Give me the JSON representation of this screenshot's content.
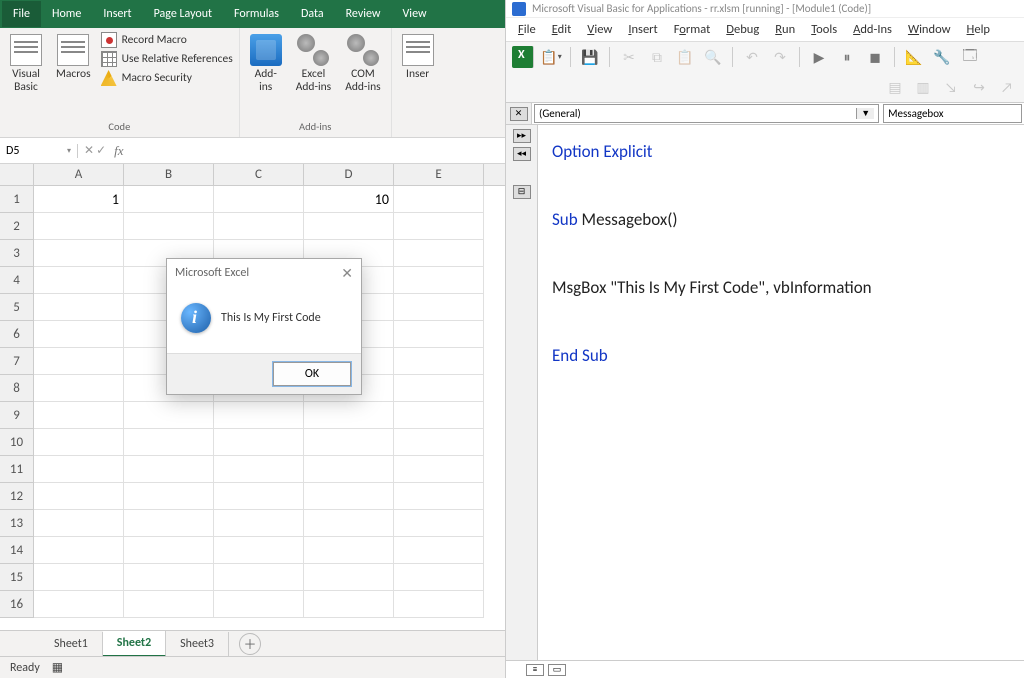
{
  "excel": {
    "tabs": [
      "File",
      "Home",
      "Insert",
      "Page Layout",
      "Formulas",
      "Data",
      "Review",
      "View"
    ],
    "ribbon": {
      "group1": {
        "big1": "Visual\nBasic",
        "big2": "Macros",
        "small1": "Record Macro",
        "small2": "Use Relative References",
        "small3": "Macro Security",
        "label": "Code"
      },
      "group2": {
        "big1": "Add-\nins",
        "big2": "Excel\nAdd-ins",
        "big3": "COM\nAdd-ins",
        "label": "Add-ins"
      },
      "group3": {
        "big1": "Inser"
      }
    },
    "namebox": "D5",
    "fx": "fx",
    "formula": "",
    "columns": [
      "A",
      "B",
      "C",
      "D",
      "E"
    ],
    "rows": [
      "1",
      "2",
      "3",
      "4",
      "5",
      "6",
      "7",
      "8",
      "9",
      "10",
      "11",
      "12",
      "13",
      "14",
      "15",
      "16"
    ],
    "cells": {
      "A1": "1",
      "D1": "10"
    },
    "sheet_tabs": [
      "Sheet1",
      "Sheet2",
      "Sheet3"
    ],
    "active_sheet": 1,
    "status": "Ready"
  },
  "msgbox": {
    "title": "Microsoft Excel",
    "text": "This Is My First Code",
    "ok": "OK"
  },
  "vba": {
    "title": "Microsoft Visual Basic for Applications - rr.xlsm [running] - [Module1 (Code)]",
    "menu": [
      "File",
      "Edit",
      "View",
      "Insert",
      "Format",
      "Debug",
      "Run",
      "Tools",
      "Add-Ins",
      "Window",
      "Help"
    ],
    "dd_left": "(General)",
    "dd_right": "Messagebox",
    "code": {
      "l1a": "Option Explicit",
      "l2a": "Sub ",
      "l2b": "Messagebox()",
      "l3": "MsgBox \"This Is My First Code\", vbInformation",
      "l4": "End Sub"
    }
  }
}
